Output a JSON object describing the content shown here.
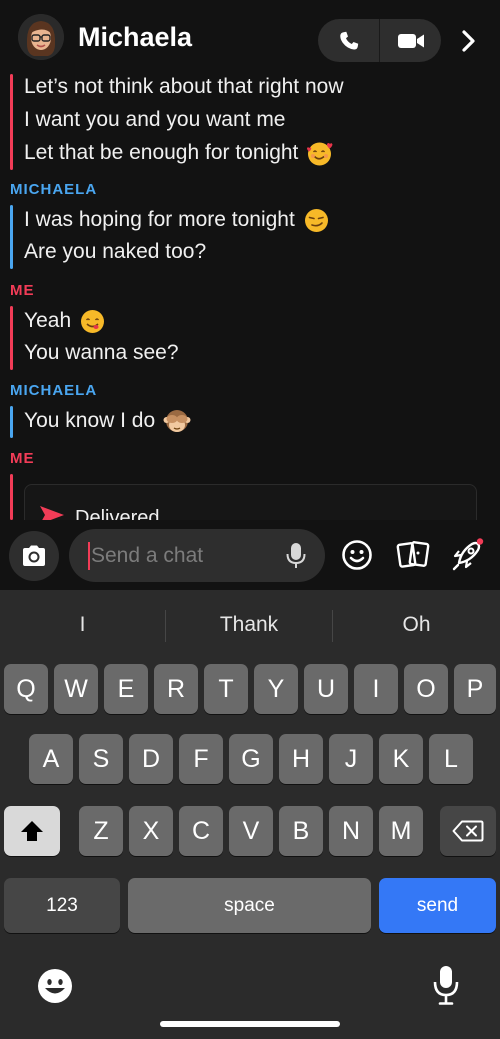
{
  "header": {
    "contact_name": "Michaela",
    "icons": {
      "avatar": "bitmoji-avatar",
      "call": "phone-icon",
      "video": "video-camera-icon",
      "more": "chevron-right-icon"
    }
  },
  "messages": {
    "groups": [
      {
        "sender": "",
        "lines": [
          "Let’s not think about that right now",
          "I want you and you want me",
          "Let that be enough for tonight"
        ]
      },
      {
        "sender": "MICHAELA",
        "lines": [
          "I was hoping for more tonight",
          "Are you naked too?"
        ]
      },
      {
        "sender": "ME",
        "lines": [
          "Yeah",
          "You wanna see?"
        ]
      },
      {
        "sender": "MICHAELA",
        "lines": [
          "You know I do"
        ]
      },
      {
        "sender": "ME",
        "lines": []
      }
    ],
    "emojis": [
      "smiling-face-with-hearts",
      "smirking-face",
      "face-savoring-food",
      "see-no-evil-monkey"
    ],
    "delivered_label": "Delivered"
  },
  "composer": {
    "placeholder": "Send a chat",
    "icons": [
      "camera-icon",
      "microphone-icon",
      "smiley-icon",
      "stickers-icon",
      "rocket-icon"
    ]
  },
  "keyboard": {
    "suggestions": [
      "I",
      "Thank",
      "Oh"
    ],
    "row1": [
      "Q",
      "W",
      "E",
      "R",
      "T",
      "Y",
      "U",
      "I",
      "O",
      "P"
    ],
    "row2": [
      "A",
      "S",
      "D",
      "F",
      "G",
      "H",
      "J",
      "K",
      "L"
    ],
    "row3": [
      "Z",
      "X",
      "C",
      "V",
      "B",
      "N",
      "M"
    ],
    "numbers_label": "123",
    "space_label": "space",
    "send_label": "send"
  },
  "colors": {
    "me": "#f23c57",
    "other": "#4aa6f0",
    "send": "#3478f6",
    "background": "#121212"
  }
}
